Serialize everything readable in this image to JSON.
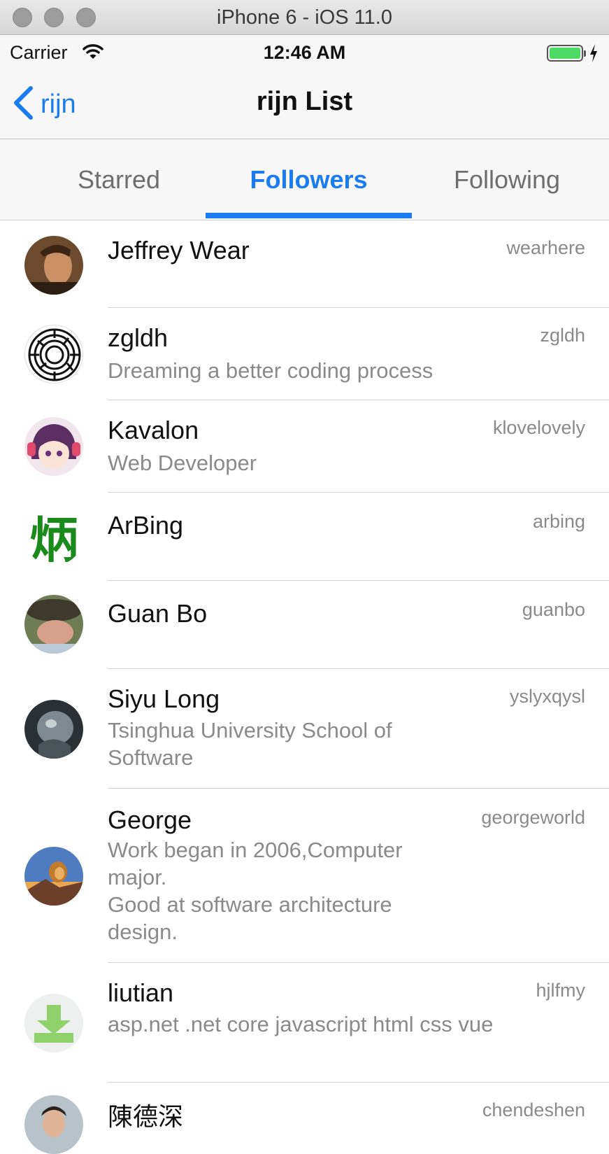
{
  "window": {
    "title": "iPhone 6 - iOS 11.0"
  },
  "status_bar": {
    "carrier": "Carrier",
    "time": "12:46 AM",
    "battery_color": "#4cd964"
  },
  "nav": {
    "back_label": "rijn",
    "title": "rijn List"
  },
  "tabs": [
    {
      "label": "Starred",
      "active": false
    },
    {
      "label": "Followers",
      "active": true
    },
    {
      "label": "Following",
      "active": false
    }
  ],
  "accent_color": "#1a7cf0",
  "users": [
    {
      "name": "Jeffrey Wear",
      "login": "wearhere",
      "bio": "",
      "avatar_icon": "photo-avatar-icon"
    },
    {
      "name": "zgldh",
      "login": "zgldh",
      "bio": "Dreaming a better coding process",
      "avatar_icon": "maze-avatar-icon"
    },
    {
      "name": "Kavalon",
      "login": "klovelovely",
      "bio": "Web Developer",
      "avatar_icon": "anime-avatar-icon"
    },
    {
      "name": "ArBing",
      "login": "arbing",
      "bio": "",
      "avatar_icon": "character-avatar-icon",
      "avatar_text": "炳"
    },
    {
      "name": "Guan Bo",
      "login": "guanbo",
      "bio": "",
      "avatar_icon": "photo-avatar-icon"
    },
    {
      "name": "Siyu Long",
      "login": "yslyxqysl",
      "bio": "Tsinghua University School of Software",
      "avatar_icon": "photo-avatar-icon"
    },
    {
      "name": "George",
      "login": "georgeworld",
      "bio": "Work began in 2006,Computer major.\nGood at software architecture design.",
      "avatar_icon": "lion-avatar-icon"
    },
    {
      "name": "liutian",
      "login": "hjlfmy",
      "bio": "asp.net .net core javascript html  css vue",
      "avatar_icon": "download-avatar-icon"
    },
    {
      "name": "陳德深",
      "login": "chendeshen",
      "bio": "",
      "avatar_icon": "photo-avatar-icon"
    }
  ]
}
